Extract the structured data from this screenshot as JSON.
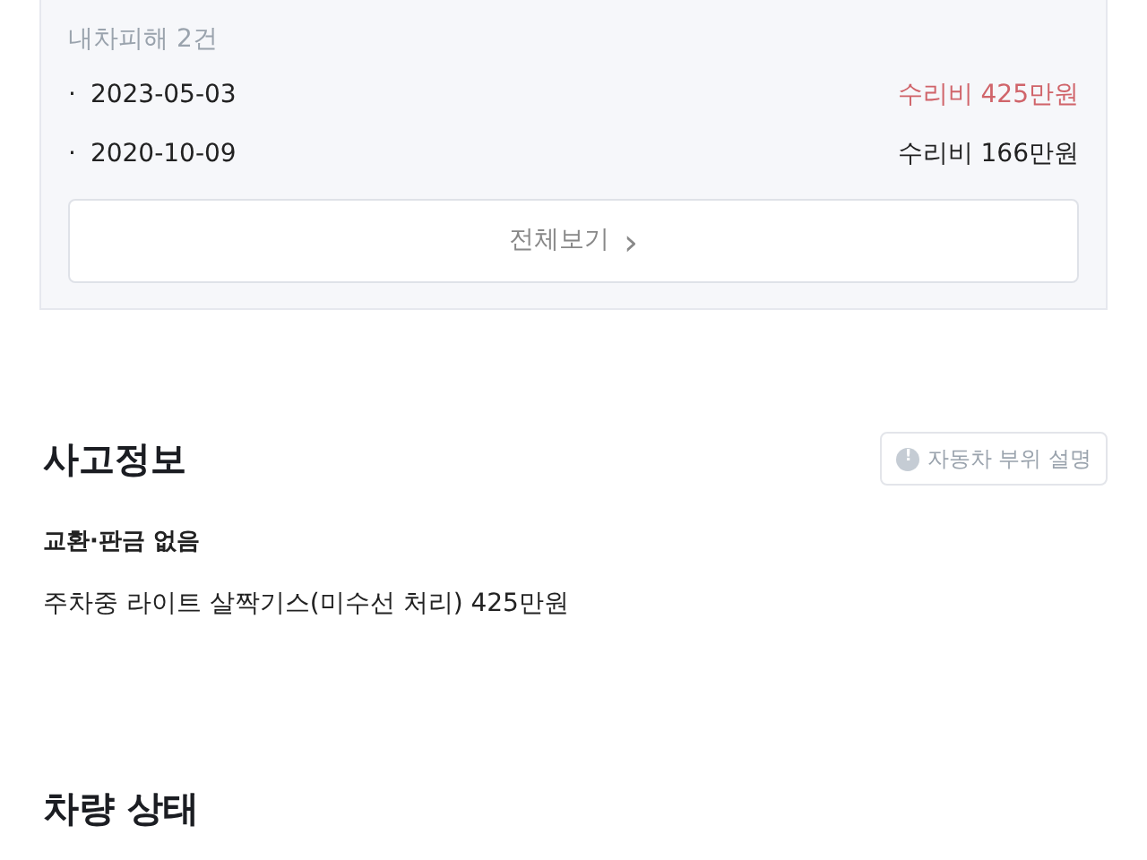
{
  "damage_card": {
    "title": "내차피해 2건",
    "records": [
      {
        "date": "2023-05-03",
        "cost": "수리비 425만원",
        "color": "#d0646a"
      },
      {
        "date": "2020-10-09",
        "cost": "수리비 166만원",
        "color": "#222222"
      }
    ],
    "bullet": "·",
    "view_all": {
      "label": "전체보기",
      "arrow": "›"
    }
  },
  "accident_info": {
    "heading": "사고정보",
    "help_button": {
      "icon": "!",
      "label": "자동차 부위 설명"
    },
    "subheading": "교환·판금 없음",
    "detail": "주차중 라이트 살짝기스(미수선 처리) 425만원"
  },
  "vehicle_status": {
    "heading": "차량 상태"
  }
}
